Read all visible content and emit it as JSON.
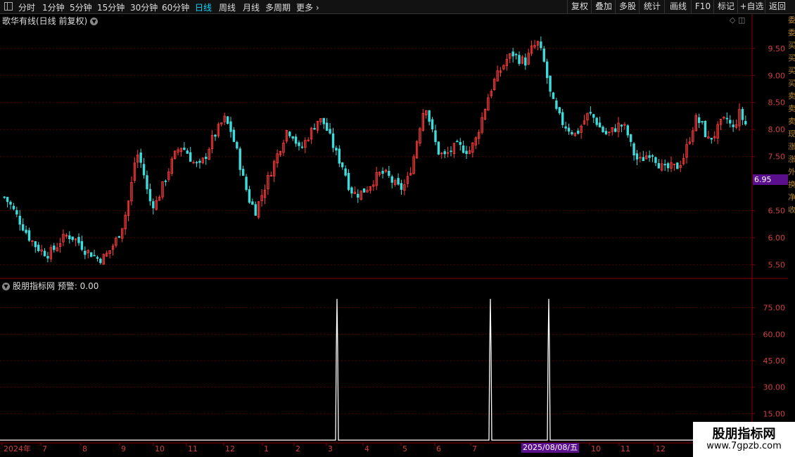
{
  "toolbar": {
    "tabs": [
      "分时",
      "1分钟",
      "5分钟",
      "15分钟",
      "30分钟",
      "60分钟",
      "日线",
      "周线",
      "月线",
      "多周期",
      "更多"
    ],
    "active": "日线",
    "right_buttons": [
      "复权",
      "叠加",
      "多股",
      "统计",
      "画线",
      "F10",
      "标记",
      "+自选",
      "返回"
    ]
  },
  "chart_title": "歌华有线(日线 前复权)",
  "indicator_title": "股朋指标网  预警: 0.00",
  "current_price": "6.95",
  "cursor_date": "2025/08/08/五",
  "watermark": {
    "line1": "股朋指标网",
    "line2": "www.7gpzb.com"
  },
  "right_strip": [
    "委",
    "委",
    "买",
    "买",
    "买",
    "买",
    "卖",
    "卖",
    "卖",
    "现",
    "涨",
    "涨",
    "外",
    "换",
    "净",
    "收"
  ],
  "price_ticks": [
    "9.50",
    "9.00",
    "8.50",
    "8.00",
    "7.50",
    "6.50",
    "6.00",
    "5.50"
  ],
  "indicator_ticks": [
    "75.00",
    "60.00",
    "45.00",
    "30.00",
    "15.00"
  ],
  "x_labels": [
    "2024年",
    "7",
    "8",
    "9",
    "10",
    "11",
    "12",
    "1",
    "2",
    "3",
    "4",
    "5",
    "6",
    "7",
    "8",
    "9",
    "10",
    "11",
    "12"
  ],
  "colors": {
    "up": "#ff3c3c",
    "down": "#3cdcdc",
    "axis": "#8c0000",
    "grid": "#5a0000",
    "signal": "#ffffff"
  },
  "chart_data": {
    "type": "candlestick",
    "y_range": [
      5.3,
      9.9
    ],
    "indicator_range": [
      0,
      90
    ],
    "signal_dates_approx": [
      "2025-03",
      "2025-07",
      "2025-08"
    ],
    "signal_value": 80,
    "close_path": [
      6.75,
      6.6,
      6.4,
      6.2,
      6.0,
      5.85,
      5.75,
      5.7,
      5.8,
      5.95,
      6.05,
      6.0,
      5.9,
      5.75,
      5.7,
      5.6,
      5.65,
      5.8,
      6.0,
      6.3,
      6.8,
      7.6,
      7.3,
      6.7,
      6.6,
      6.9,
      7.2,
      7.5,
      7.7,
      7.6,
      7.4,
      7.3,
      7.5,
      7.8,
      8.0,
      8.2,
      8.0,
      7.6,
      7.1,
      6.7,
      6.5,
      6.8,
      7.1,
      7.4,
      7.7,
      8.0,
      7.9,
      7.6,
      7.8,
      8.0,
      8.2,
      8.1,
      7.8,
      7.5,
      7.3,
      6.9,
      6.8,
      6.85,
      6.95,
      7.1,
      7.2,
      7.15,
      7.0,
      6.9,
      7.0,
      7.4,
      8.0,
      8.5,
      8.0,
      7.6,
      7.5,
      7.6,
      7.7,
      7.65,
      7.6,
      7.8,
      8.2,
      8.6,
      8.9,
      9.1,
      9.3,
      9.4,
      9.3,
      9.25,
      9.5,
      9.6,
      9.2,
      8.6,
      8.3,
      8.1,
      8.0,
      7.9,
      8.1,
      8.3,
      8.2,
      8.0,
      7.9,
      8.0,
      8.1,
      8.0,
      7.6,
      7.4,
      7.5,
      7.6,
      7.4,
      7.25,
      7.3,
      7.3,
      7.45,
      7.8,
      8.2,
      8.1,
      7.8,
      7.9,
      8.1,
      8.2,
      8.0,
      8.3,
      8.1
    ]
  }
}
